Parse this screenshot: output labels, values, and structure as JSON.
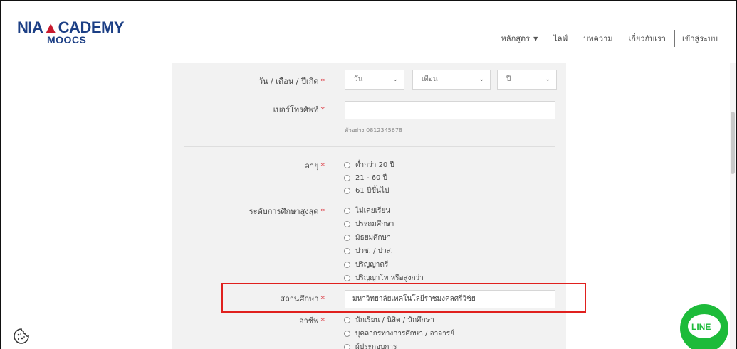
{
  "header": {
    "logo_main_left": "NIA",
    "logo_main_right": "CADEMY",
    "logo_sub": "MOOCS",
    "nav": [
      {
        "label": "หลักสูตร",
        "has_caret": true
      },
      {
        "label": "ไลฟ์"
      },
      {
        "label": "บทความ"
      },
      {
        "label": "เกี่ยวกับเรา"
      }
    ],
    "login": "เข้าสู่ระบบ"
  },
  "form": {
    "birthdate": {
      "label": "วัน / เดือน / ปีเกิด",
      "required": "*",
      "day": "วัน",
      "month": "เดือน",
      "year": "ปี"
    },
    "phone": {
      "label": "เบอร์โทรศัพท์",
      "required": "*",
      "value": "",
      "hint": "ตัวอย่าง 0812345678"
    },
    "age": {
      "label": "อายุ",
      "required": "*",
      "options": [
        "ต่ำกว่า 20 ปี",
        "21 - 60 ปี",
        "61 ปีขึ้นไป"
      ]
    },
    "education": {
      "label": "ระดับการศึกษาสูงสุด",
      "required": "*",
      "options": [
        "ไม่เคยเรียน",
        "ประถมศึกษา",
        "มัธยมศึกษา",
        "ปวช. / ปวส.",
        "ปริญญาตรี",
        "ปริญญาโท หรือสูงกว่า"
      ]
    },
    "institution": {
      "label": "สถานศึกษา",
      "required": "*",
      "value": "มหาวิทยาลัยเทคโนโลยีราชมงคลศรีวิชัย"
    },
    "occupation": {
      "label": "อาชีพ",
      "required": "*",
      "options": [
        "นักเรียน / นิสิต / นักศึกษา",
        "บุคลากรทางการศึกษา / อาจารย์",
        "ผู้ประกอบการ"
      ]
    }
  },
  "widgets": {
    "line_label": "LINE",
    "highlight_color": "#e0201e",
    "line_color": "#1dbb3a",
    "brand_blue": "#1c3f85"
  }
}
